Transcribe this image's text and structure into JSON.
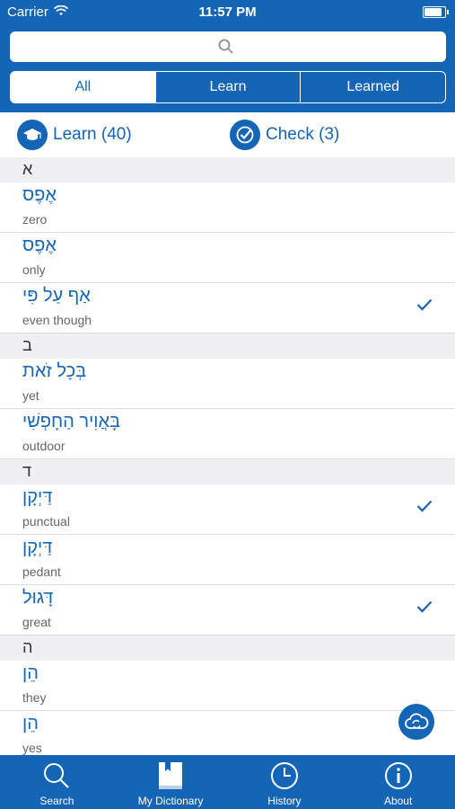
{
  "status": {
    "carrier": "Carrier",
    "time": "11:57 PM"
  },
  "search": {
    "placeholder": ""
  },
  "segments": [
    "All",
    "Learn",
    "Learned"
  ],
  "actions": {
    "learn": "Learn (40)",
    "check": "Check (3)"
  },
  "sections": [
    {
      "letter": "א",
      "rows": [
        {
          "heb": "אֶפֶס",
          "eng": "zero",
          "checked": false
        },
        {
          "heb": "אֶפֶס",
          "eng": "only",
          "checked": false
        },
        {
          "heb": "אַף עַל פִּי",
          "eng": "even though",
          "checked": true
        }
      ]
    },
    {
      "letter": "ב",
      "rows": [
        {
          "heb": "בְּכָל זֹאת",
          "eng": "yet",
          "checked": false
        },
        {
          "heb": "בָּאֲוִיר הַחָפְשִׁי",
          "eng": "outdoor",
          "checked": false
        }
      ]
    },
    {
      "letter": "ד",
      "rows": [
        {
          "heb": "דַּיְקָן",
          "eng": "punctual",
          "checked": true
        },
        {
          "heb": "דַּיְקָן",
          "eng": "pedant",
          "checked": false
        },
        {
          "heb": "דָּגוּל",
          "eng": "great",
          "checked": true
        }
      ]
    },
    {
      "letter": "ה",
      "rows": [
        {
          "heb": "הֵן",
          "eng": "they",
          "checked": false
        },
        {
          "heb": "הֵן",
          "eng": "yes",
          "checked": false
        }
      ]
    }
  ],
  "tabs": [
    "Search",
    "My Dictionary",
    "History",
    "About"
  ],
  "colors": {
    "primary": "#1565b7",
    "section_bg": "#efeff4"
  }
}
